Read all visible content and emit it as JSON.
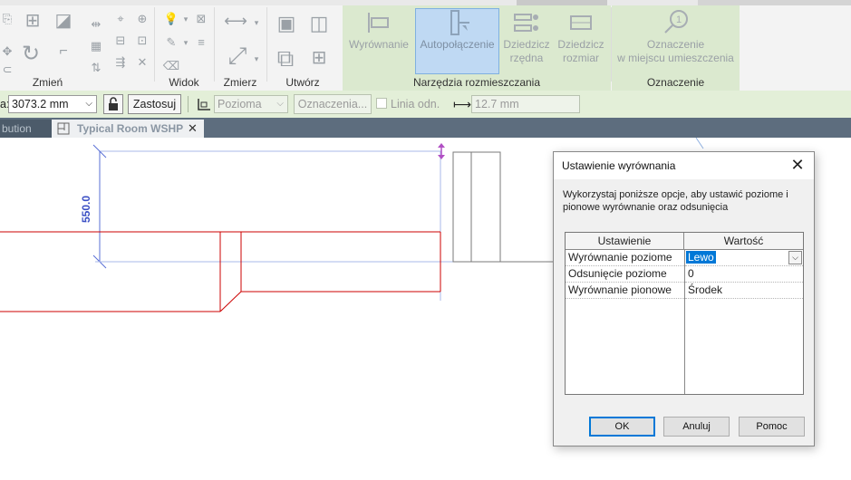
{
  "ribbon": {
    "panels": {
      "modify": "Zmień",
      "view": "Widok",
      "measure": "Zmierz",
      "create": "Utwórz",
      "placement_tools": "Narzędzia rozmieszczania",
      "tag": "Oznaczenie"
    },
    "buttons": {
      "align": "Wyrównanie",
      "autoconnect": "Autopołączenie",
      "inherit_elevation_1": "Dziedzicz",
      "inherit_elevation_2": "rzędna",
      "inherit_size_1": "Dziedzicz",
      "inherit_size_2": "rozmiar",
      "tag_on_place_1": "Oznaczenie",
      "tag_on_place_2": "w miejscu umieszczenia"
    }
  },
  "options_bar": {
    "offset_label_fragment": "a:",
    "offset_value": "3073.2 mm",
    "apply_button": "Zastosuj",
    "orientation_value": "Pozioma",
    "tags_button": "Oznaczenia...",
    "leader_label": "Linia odn.",
    "leader_length": "12.7 mm"
  },
  "view_tabs": {
    "partial_tab": "bution",
    "active_tab": "Typical Room WSHP"
  },
  "drawing": {
    "dimension_text": "550.0"
  },
  "dialog": {
    "title": "Ustawienie wyrównania",
    "description": "Wykorzystaj poniższe opcje, aby ustawić poziome i pionowe wyrównanie oraz odsunięcia",
    "columns": [
      "Ustawienie",
      "Wartość"
    ],
    "rows": [
      {
        "setting": "Wyrównanie poziome",
        "value": "Lewo"
      },
      {
        "setting": "Odsunięcie poziome",
        "value": "0"
      },
      {
        "setting": "Wyrównanie pionowe",
        "value": "Środek"
      }
    ],
    "buttons": {
      "ok": "OK",
      "cancel": "Anuluj",
      "help": "Pomoc"
    }
  },
  "colors": {
    "accent_selection": "#0078d7",
    "context_panel": "#dbe9cf",
    "options_bar": "#e3efd8",
    "duct_red": "#cc0000",
    "dimension_blue": "#3b4fc4"
  }
}
